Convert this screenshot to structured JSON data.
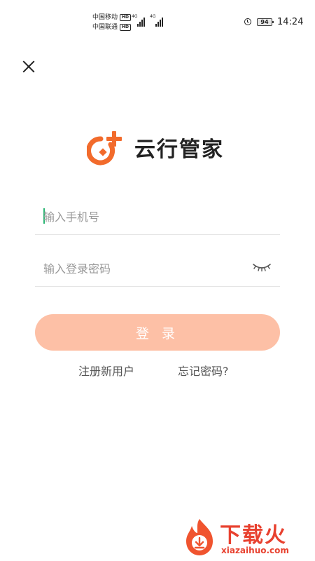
{
  "status_bar": {
    "carrier_1": "中国移动",
    "carrier_2": "中国联通",
    "hd_label": "HD",
    "network_1": "4G",
    "network_2": "4G",
    "battery": "94",
    "time": "14:24"
  },
  "app": {
    "name": "云行管家",
    "brand_color": "#f26b2c"
  },
  "login_form": {
    "phone_placeholder": "输入手机号",
    "phone_value": "",
    "password_placeholder": "输入登录密码",
    "password_value": "",
    "login_label": "登 录",
    "login_button_color": "#fdc0a6",
    "register_link": "注册新用户",
    "forgot_link": "忘记密码?"
  },
  "watermark": {
    "brand": "下载火",
    "url": "xiazaihuo.com",
    "color": "#e8412f"
  }
}
